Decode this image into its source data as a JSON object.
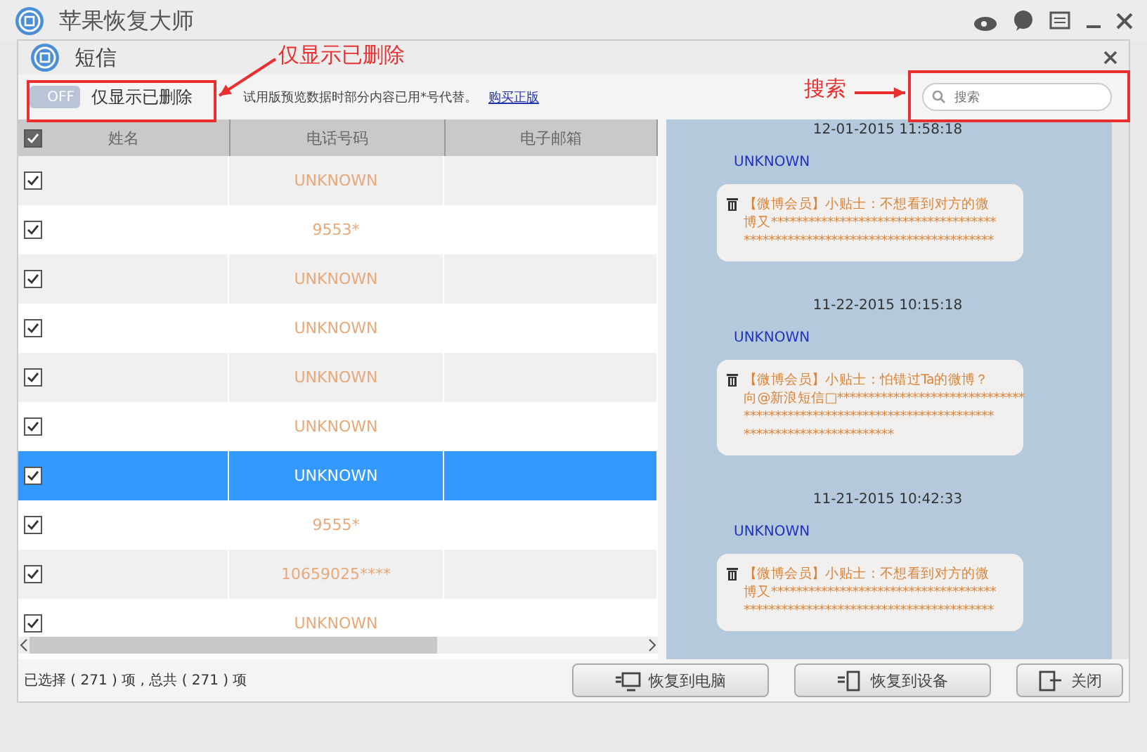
{
  "app": {
    "title": "苹果恢复大师"
  },
  "dialog": {
    "title": "短信",
    "toggle": {
      "label": "OFF",
      "on": false
    },
    "filter_label": "仅显示已删除",
    "notice": "试用版预览数据时部分内容已用*号代替。",
    "link": "购买正版",
    "search": {
      "placeholder": "搜索"
    }
  },
  "table": {
    "all_checked": true,
    "columns": [
      "姓名",
      "电话号码",
      "电子邮箱"
    ],
    "rows": [
      {
        "checked": true,
        "selected": false,
        "phone": "UNKNOWN"
      },
      {
        "checked": true,
        "selected": false,
        "phone": "9553*"
      },
      {
        "checked": true,
        "selected": false,
        "phone": "UNKNOWN"
      },
      {
        "checked": true,
        "selected": false,
        "phone": "UNKNOWN"
      },
      {
        "checked": true,
        "selected": false,
        "phone": "UNKNOWN"
      },
      {
        "checked": true,
        "selected": false,
        "phone": "UNKNOWN"
      },
      {
        "checked": true,
        "selected": true,
        "phone": "UNKNOWN"
      },
      {
        "checked": true,
        "selected": false,
        "phone": "9555*"
      },
      {
        "checked": true,
        "selected": false,
        "phone": "10659025****"
      },
      {
        "checked": true,
        "selected": false,
        "phone": "UNKNOWN"
      }
    ]
  },
  "messages": [
    {
      "time": "12-01-2015 11:58:18",
      "sender": "UNKNOWN",
      "lines": [
        "【微博会员】小贴士：不想看到对方的微",
        "博又************************************",
        "****************************************"
      ]
    },
    {
      "time": "11-22-2015 10:15:18",
      "sender": "UNKNOWN",
      "lines": [
        "【微博会员】小贴士：怕错过Ta的微博？",
        "向@新浪短信□******************************",
        "****************************************",
        "************************"
      ]
    },
    {
      "time": "11-21-2015 10:42:33",
      "sender": "UNKNOWN",
      "lines": [
        "【微博会员】小贴士：不想看到对方的微",
        "博又************************************",
        "****************************************"
      ]
    }
  ],
  "status": "已选择 ( 271 ) 项 , 总共 ( 271 ) 项",
  "buttons": [
    {
      "kind": "computer",
      "label": "恢复到电脑"
    },
    {
      "kind": "device",
      "label": "恢复到设备"
    },
    {
      "kind": "close",
      "label": "关闭"
    }
  ],
  "annotations": [
    {
      "kind": "toggle",
      "text": "仅显示已删除"
    },
    {
      "kind": "search",
      "text": "搜索"
    }
  ]
}
